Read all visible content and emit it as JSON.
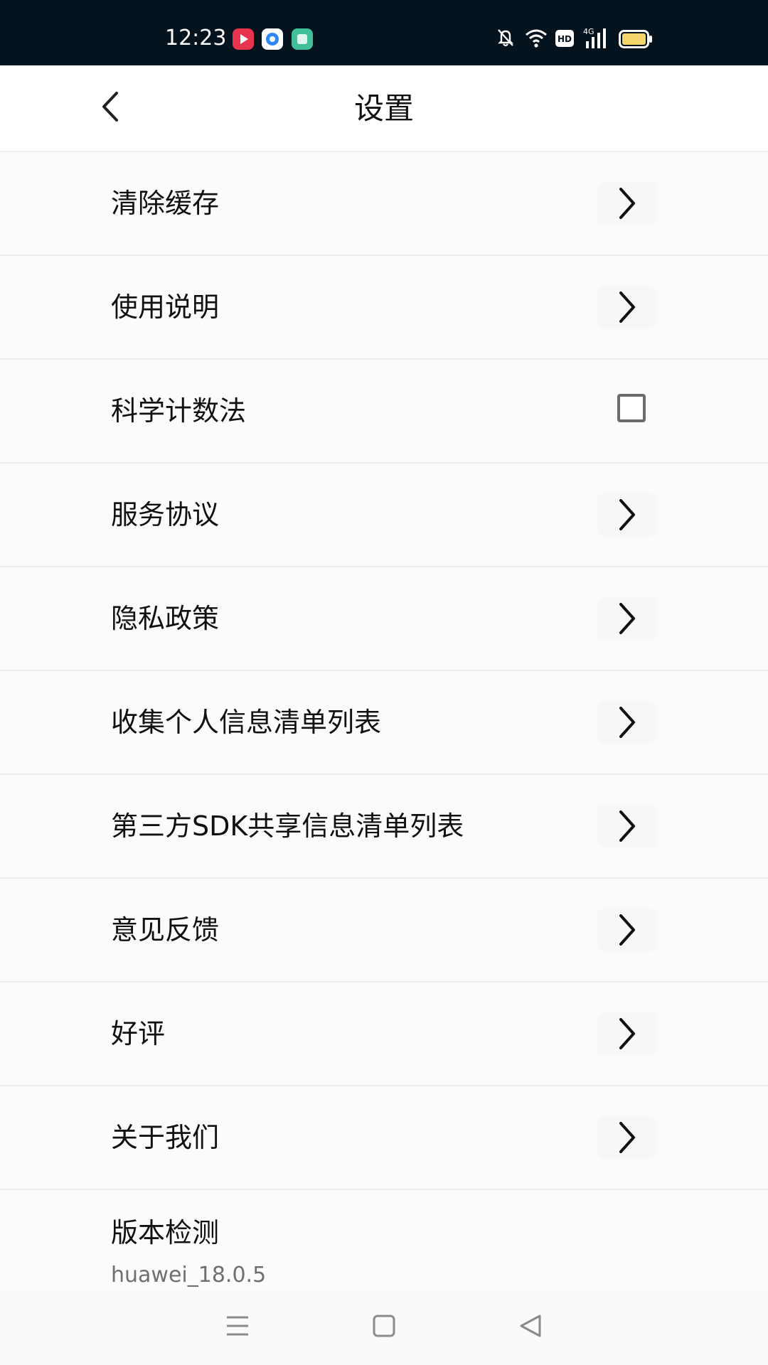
{
  "status_bar": {
    "time": "12:23",
    "notification_icons": [
      {
        "name": "video-app-icon",
        "color": "#e8334f"
      },
      {
        "name": "browser-app-icon",
        "color": "#2f86f6"
      },
      {
        "name": "gallery-app-icon",
        "color": "#3fbf9a"
      }
    ],
    "right_icons": [
      "bell-muted-icon",
      "wifi-icon",
      "hd-icon",
      "cellular-4g-icon",
      "battery-icon"
    ],
    "hd_label": "HD",
    "network_label": "4G",
    "battery_color": "#f6d66b"
  },
  "header": {
    "title": "设置",
    "back_icon": "chevron-left-icon"
  },
  "settings": {
    "items": [
      {
        "label": "清除缓存",
        "control": "chevron"
      },
      {
        "label": "使用说明",
        "control": "chevron"
      },
      {
        "label": "科学计数法",
        "control": "checkbox",
        "checked": false
      },
      {
        "label": "服务协议",
        "control": "chevron"
      },
      {
        "label": "隐私政策",
        "control": "chevron"
      },
      {
        "label": "收集个人信息清单列表",
        "control": "chevron"
      },
      {
        "label": "第三方SDK共享信息清单列表",
        "control": "chevron"
      },
      {
        "label": "意见反馈",
        "control": "chevron"
      },
      {
        "label": "好评",
        "control": "chevron"
      },
      {
        "label": "关于我们",
        "control": "chevron"
      }
    ],
    "version": {
      "label": "版本检测",
      "value": "huawei_18.0.5"
    }
  },
  "nav_bar": {
    "buttons": [
      "menu-icon",
      "home-icon",
      "back-triangle-icon"
    ]
  }
}
